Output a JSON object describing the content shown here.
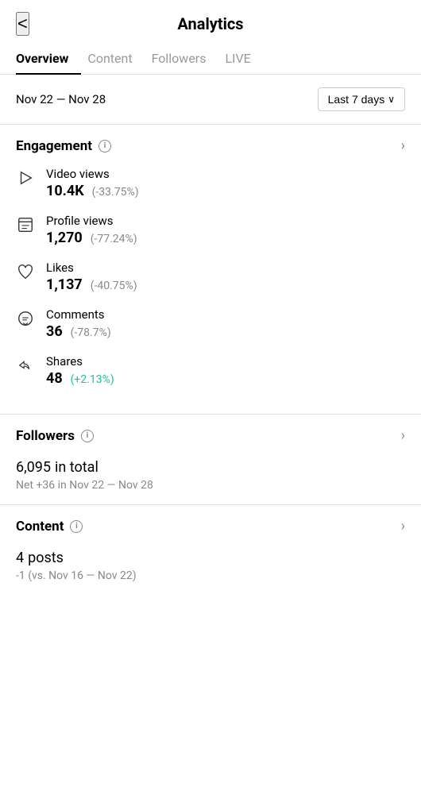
{
  "header": {
    "back_label": "<",
    "title": "Analytics"
  },
  "tabs": [
    {
      "label": "Overview",
      "active": true
    },
    {
      "label": "Content",
      "active": false
    },
    {
      "label": "Followers",
      "active": false
    },
    {
      "label": "LIVE",
      "active": false
    }
  ],
  "date_range": {
    "range_text": "Nov 22 — Nov 28",
    "filter_label": "Last 7 days",
    "filter_chevron": "∨"
  },
  "engagement_section": {
    "title": "Engagement",
    "metrics": [
      {
        "id": "video-views",
        "label": "Video views",
        "value": "10.4K",
        "change": "(-33.75%)",
        "positive": false,
        "icon": "play"
      },
      {
        "id": "profile-views",
        "label": "Profile views",
        "value": "1,270",
        "change": "(-77.24%)",
        "positive": false,
        "icon": "profile"
      },
      {
        "id": "likes",
        "label": "Likes",
        "value": "1,137",
        "change": "(-40.75%)",
        "positive": false,
        "icon": "heart"
      },
      {
        "id": "comments",
        "label": "Comments",
        "value": "36",
        "change": "(-78.7%)",
        "positive": false,
        "icon": "comment"
      },
      {
        "id": "shares",
        "label": "Shares",
        "value": "48",
        "change": "(+2.13%)",
        "positive": true,
        "icon": "share"
      }
    ]
  },
  "followers_section": {
    "title": "Followers",
    "total_value": "6,095",
    "total_label": "in total",
    "net_text": "Net +36 in Nov 22 — Nov 28"
  },
  "content_section": {
    "title": "Content",
    "posts_value": "4",
    "posts_label": "posts",
    "posts_change": "-1 (vs. Nov 16 — Nov 22)"
  },
  "colors": {
    "accent": "#20c0a0",
    "negative": "#888888",
    "border": "#e0e0e0"
  }
}
